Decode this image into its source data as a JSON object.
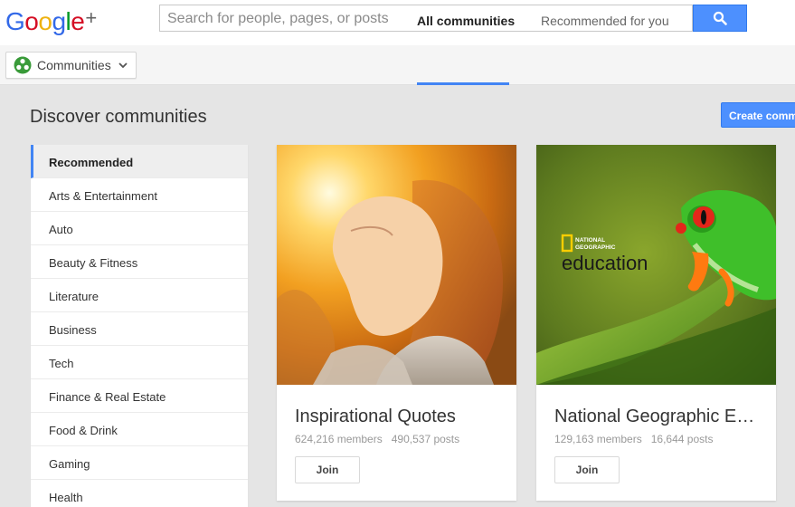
{
  "header": {
    "logo_letters": [
      "G",
      "o",
      "o",
      "g",
      "l",
      "e"
    ],
    "logo_plus": "+",
    "search_placeholder": "Search for people, pages, or posts"
  },
  "subnav": {
    "dropdown_label": "Communities",
    "tabs": [
      {
        "label": "All communities",
        "active": true
      },
      {
        "label": "Recommended for you",
        "active": false
      }
    ]
  },
  "page": {
    "title": "Discover communities",
    "create_button": "Create community"
  },
  "sidebar": {
    "items": [
      {
        "label": "Recommended",
        "active": true
      },
      {
        "label": "Arts & Entertainment"
      },
      {
        "label": "Auto"
      },
      {
        "label": "Beauty & Fitness"
      },
      {
        "label": "Literature"
      },
      {
        "label": "Business"
      },
      {
        "label": "Tech"
      },
      {
        "label": "Finance & Real Estate"
      },
      {
        "label": "Food & Drink"
      },
      {
        "label": "Gaming"
      },
      {
        "label": "Health"
      }
    ]
  },
  "cards": [
    {
      "title": "Inspirational Quotes",
      "members": "624,216 members",
      "posts": "490,537 posts",
      "join_label": "Join"
    },
    {
      "title": "National Geographic Education",
      "members": "129,163 members",
      "posts": "16,644 posts",
      "join_label": "Join",
      "logo_line1": "NATIONAL",
      "logo_line2": "GEOGRAPHIC",
      "logo_word": "education"
    }
  ],
  "colors": {
    "accent": "#4285f4",
    "button_blue": "#4d90fe",
    "brand_yellow": "#ffce00"
  }
}
